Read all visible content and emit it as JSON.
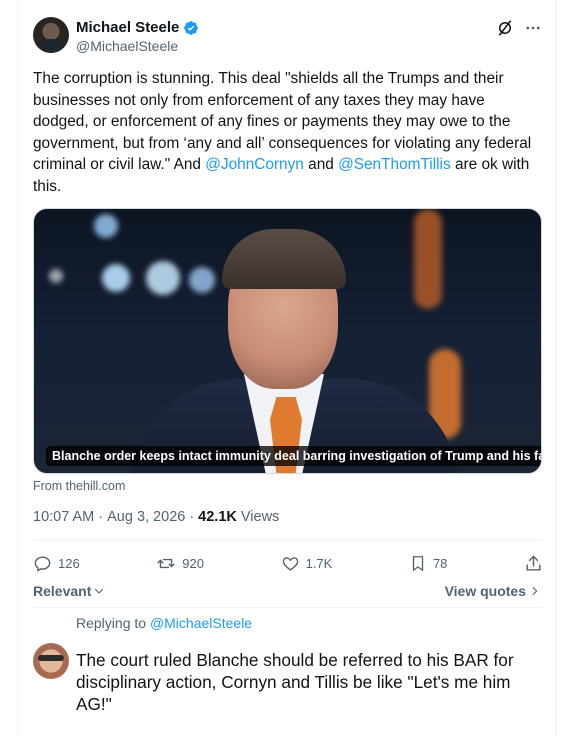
{
  "author": {
    "display_name": "Michael Steele",
    "handle": "@MichaelSteele",
    "verified": true
  },
  "header_icons": [
    "grok-icon",
    "more-icon"
  ],
  "tweet": {
    "text_before": "The corruption is stunning.  This deal \"shields all the Trumps and their businesses not only from enforcement of any taxes they may have dodged, or enforcement of any fines or payments they may owe to the government, but from ‘any and all’ consequences for violating any federal criminal or civil law.\" And ",
    "mention_1": "@JohnCornyn",
    "text_middle": " and ",
    "mention_2": "@SenThomTillis",
    "text_after": " are ok with this."
  },
  "media": {
    "caption": "Blanche order keeps intact immunity deal barring investigation of Trump and his family",
    "source": "From thehill.com"
  },
  "meta": {
    "time": "10:07 AM",
    "date": "Aug 3, 2026",
    "views_count": "42.1K",
    "views_label": "Views"
  },
  "actions": {
    "replies": "126",
    "reposts": "920",
    "likes": "1.7K",
    "bookmarks": "78"
  },
  "sort": {
    "label": "Relevant",
    "view_quotes": "View quotes"
  },
  "reply": {
    "replying_prefix": "Replying to",
    "replying_to": "@MichaelSteele",
    "text": "The court ruled Blanche should be referred to his BAR for disciplinary action, Cornyn and Tillis be like \"Let's me him AG!\""
  },
  "colors": {
    "accent": "#1d9bf0",
    "text_primary": "#0f1419",
    "text_secondary": "#536471"
  }
}
